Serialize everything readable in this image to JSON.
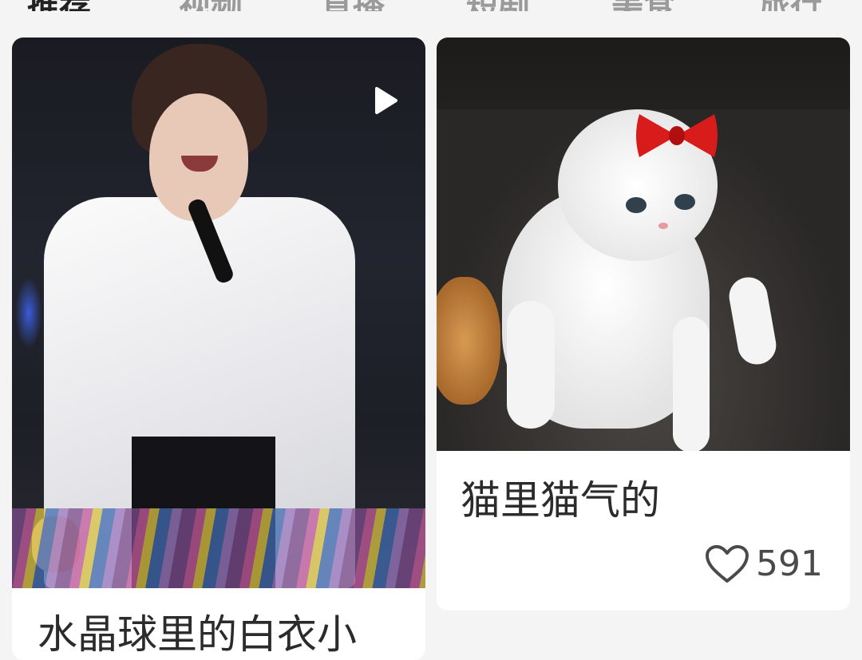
{
  "tabs": [
    {
      "label": "推荐",
      "active": true
    },
    {
      "label": "视频",
      "active": false
    },
    {
      "label": "直播",
      "active": false
    },
    {
      "label": "短剧",
      "active": false
    },
    {
      "label": "美食",
      "active": false
    },
    {
      "label": "旅行",
      "active": false
    }
  ],
  "cards": {
    "left": {
      "caption": "水晶球里的白衣小",
      "icon": "play-icon"
    },
    "right": {
      "caption": "猫里猫气的",
      "like_icon": "heart-outline-icon",
      "likes": "591"
    }
  },
  "colors": {
    "background": "#f4f4f4",
    "card": "#ffffff",
    "text": "#2b2b2b",
    "bow_red": "#d81b1b"
  }
}
